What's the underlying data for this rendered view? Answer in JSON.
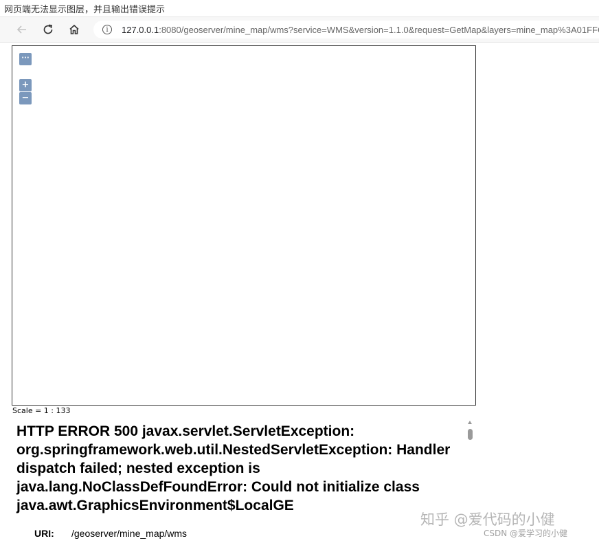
{
  "caption": "网页端无法显示图层，并且输出错误提示",
  "browser": {
    "url_host": "127.0.0.1",
    "url_rest": ":8080/geoserver/mine_map/wms?service=WMS&version=1.1.0&request=GetMap&layers=mine_map%3A01FFC82D-941",
    "icons": [
      "back-arrow-icon",
      "reload-icon",
      "home-icon",
      "info-icon"
    ]
  },
  "map": {
    "more_button": "···",
    "zoom_in": "+",
    "zoom_out": "−",
    "button_color": "#7b98bc",
    "scale_text": "Scale = 1 : 133"
  },
  "error": {
    "title": "HTTP ERROR 500 javax.servlet.ServletException: org.springframework.web.util.NestedServletException: Handler dispatch failed; nested exception is java.lang.NoClassDefFoundError: Could not initialize class java.awt.GraphicsEnvironment$LocalGE",
    "uri_label": "URI:",
    "uri_value": "/geoserver/mine_map/wms"
  },
  "watermark": {
    "main": "知乎 @爱代码的小健",
    "sub": "CSDN @爱学习的小健"
  }
}
